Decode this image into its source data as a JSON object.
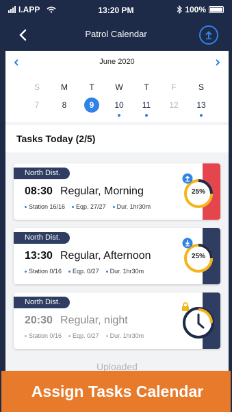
{
  "status_bar": {
    "carrier": "I.APP",
    "time": "13:20 PM",
    "battery": "100%"
  },
  "header": {
    "title": "Patrol Calendar",
    "back_icon": "chevron-left-icon",
    "upload_icon": "upload-icon"
  },
  "calendar": {
    "month": "June 2020",
    "weekdays": [
      "S",
      "M",
      "T",
      "W",
      "T",
      "F",
      "S"
    ],
    "days": [
      {
        "num": "7",
        "muted": true,
        "selected": false,
        "dot": false
      },
      {
        "num": "8",
        "muted": false,
        "selected": false,
        "dot": false
      },
      {
        "num": "9",
        "muted": false,
        "selected": true,
        "dot": false
      },
      {
        "num": "10",
        "muted": false,
        "selected": false,
        "dot": true
      },
      {
        "num": "11",
        "muted": false,
        "selected": false,
        "dot": true
      },
      {
        "num": "12",
        "muted": true,
        "selected": false,
        "dot": false
      },
      {
        "num": "13",
        "muted": false,
        "selected": false,
        "dot": true
      }
    ]
  },
  "tasks": {
    "title": "Tasks Today (2/5)",
    "items": [
      {
        "district": "North Dist.",
        "time": "08:30",
        "name": "Regular, Morning",
        "station": "Station 16/16",
        "equipment": "Eqp. 27/27",
        "duration": "Dur.  1hr30m",
        "progress_label": "25%",
        "progress": 0.25,
        "status_icon": "upload-icon",
        "side_color": "#e5464e",
        "muted": false
      },
      {
        "district": "North Dist.",
        "time": "13:30",
        "name": "Regular, Afternoon",
        "station": "Station 0/16",
        "equipment": "Eqp. 0/27",
        "duration": "Dur.  1hr30m",
        "progress_label": "25%",
        "progress": 0.25,
        "status_icon": "download-icon",
        "side_color": "#2e3d61",
        "muted": false
      },
      {
        "district": "North Dist.",
        "time": "20:30",
        "name": "Regular, night",
        "station": "Station 0/16",
        "equipment": "Eqp. 0/27",
        "duration": "Dur.  1hr30m",
        "status_icon": "clock-lock-icon",
        "side_color": "#2e3d61",
        "muted": true
      }
    ],
    "uploaded_label": "Uploaded"
  },
  "banner": {
    "text": "Assign Tasks Calendar"
  },
  "colors": {
    "navy": "#1d2a48",
    "accent": "#2f82e6",
    "red": "#e5464e",
    "orange": "#e77b2b",
    "gold": "#f5b41a"
  }
}
